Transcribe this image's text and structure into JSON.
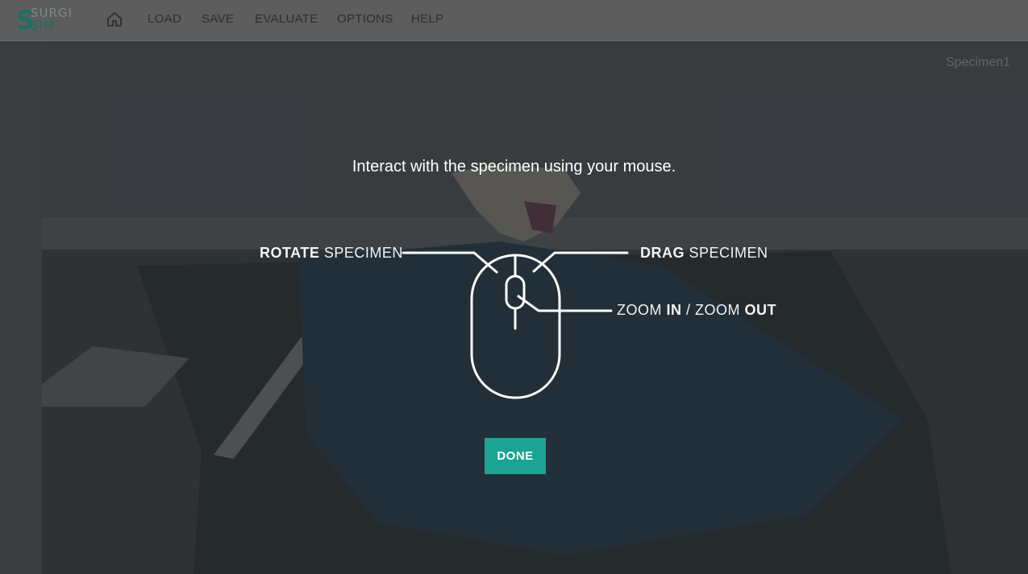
{
  "app": {
    "logo_letter": "S",
    "logo_line1": "SURGI",
    "logo_line2": "SIM"
  },
  "nav": {
    "items": [
      {
        "label": "LOAD"
      },
      {
        "label": "SAVE"
      },
      {
        "label": "EVALUATE"
      },
      {
        "label": "OPTIONS"
      },
      {
        "label": "HELP"
      }
    ]
  },
  "specimen_name": "Specimen1",
  "tutorial": {
    "instruction": "Interact with the specimen using your mouse.",
    "rotate": {
      "bold": "ROTATE",
      "rest": " SPECIMEN"
    },
    "drag": {
      "bold": "DRAG",
      "rest": " SPECIMEN"
    },
    "zoom": {
      "part1": "ZOOM ",
      "bold1": "IN",
      "part2": " / ZOOM ",
      "bold2": "OUT"
    },
    "done_label": "DONE"
  },
  "colors": {
    "accent": "#1aa392",
    "logo": "#1e6f63"
  }
}
